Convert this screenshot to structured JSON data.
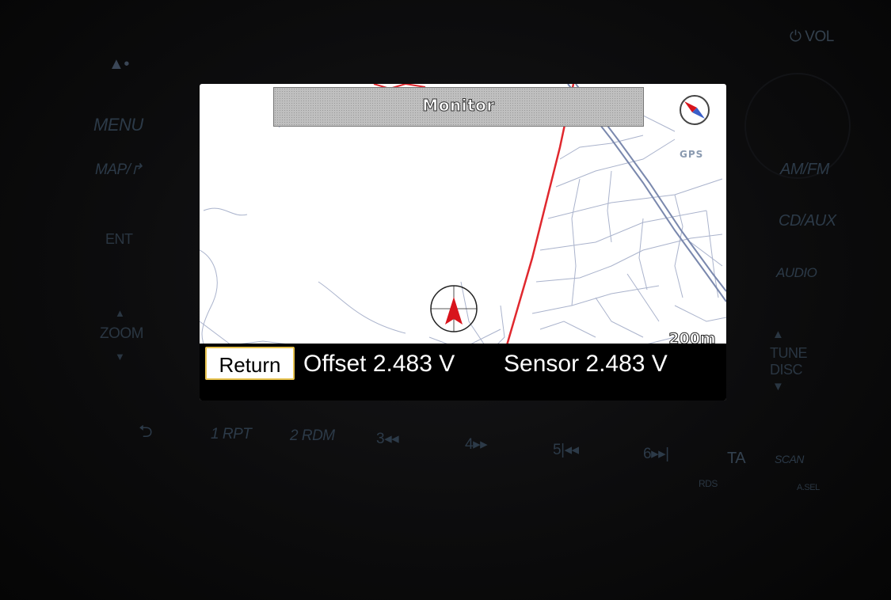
{
  "screen": {
    "title": "Monitor",
    "gps_label": "GPS",
    "scale_label": "200m",
    "return_label": "Return",
    "offset_text": "Offset 2.483 V",
    "sensor_text": "Sensor 2.483 V"
  },
  "panel": {
    "eject": "▲•",
    "menu": "MENU",
    "map": "MAP/↱",
    "ent": "ENT",
    "zoom_up": "▲",
    "zoom": "ZOOM",
    "zoom_down": "▼",
    "back": "⮌",
    "preset1": "1 RPT",
    "preset2": "2 RDM",
    "preset3": "3◂◂",
    "preset4": "4▸▸",
    "preset5": "5|◂◂",
    "preset6": "6▸▸|",
    "ta": "TA",
    "rds": "RDS",
    "scan": "SCAN",
    "asel": "A.SEL",
    "vol": "⏻ VOL",
    "amfm": "AM/FM",
    "cdaux": "CD/AUX",
    "audio": "AUDIO",
    "tune_up": "▲",
    "tune": "TUNE",
    "disc": "DISC",
    "tune_down": "▼"
  },
  "colors": {
    "route": "#e0282e",
    "road": "#9aa6c4",
    "highway": "#6f7fa6",
    "return_border": "#e7c24e",
    "panel_text": "#2c3a48"
  },
  "icons": {
    "compass": "compass-icon",
    "vehicle": "vehicle-position-icon",
    "eject": "eject-icon",
    "back": "back-arrow-icon",
    "power": "power-icon"
  }
}
